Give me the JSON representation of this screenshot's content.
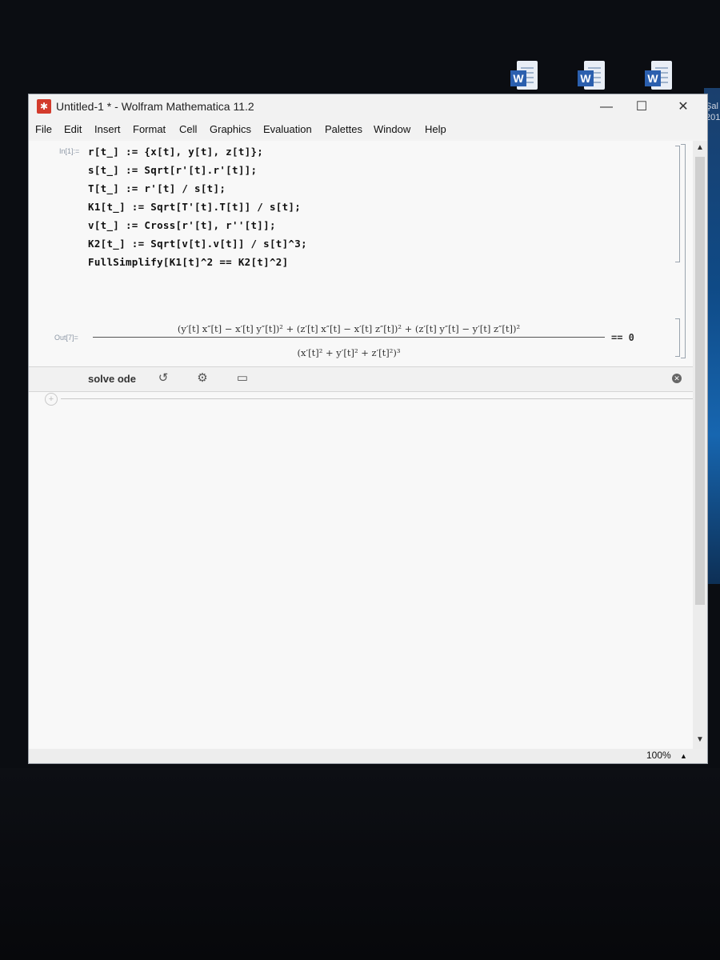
{
  "window": {
    "title": "Untitled-1 * - Wolfram Mathematica 11.2",
    "icon": "mathematica-logo-icon",
    "controls": {
      "minimize": "—",
      "maximize": "☐",
      "close": "✕"
    }
  },
  "menu": [
    "File",
    "Edit",
    "Insert",
    "Format",
    "Cell",
    "Graphics",
    "Evaluation",
    "Palettes",
    "Window",
    "Help"
  ],
  "notebook": {
    "input_label": "In[1]:=",
    "input_lines": [
      "r[t_] := {x[t], y[t], z[t]};",
      "s[t_] := Sqrt[r'[t].r'[t]];",
      "T[t_] := r'[t] / s[t];",
      "K1[t_] := Sqrt[T'[t].T[t]] / s[t];",
      "v[t_] := Cross[r'[t], r''[t]];",
      "K2[t_] := Sqrt[v[t].v[t]] / s[t]^3;",
      "FullSimplify[K1[t]^2 == K2[t]^2]"
    ],
    "output_label": "Out[7]=",
    "output_numerator": "(y′[t] x″[t] − x′[t] y″[t])² + (z′[t] x″[t] − x′[t] z″[t])² + (z′[t] y″[t] − y′[t] z″[t])²",
    "output_denominator": "(x′[t]² + y′[t]² + z′[t]²)³",
    "output_rhs": "== 0"
  },
  "suggestions_bar": {
    "label": "solve ode"
  },
  "status": {
    "zoom": "100%",
    "zoom_arrow": "▲"
  },
  "desktop": {
    "side_text": [
      "Şal",
      "201"
    ]
  }
}
